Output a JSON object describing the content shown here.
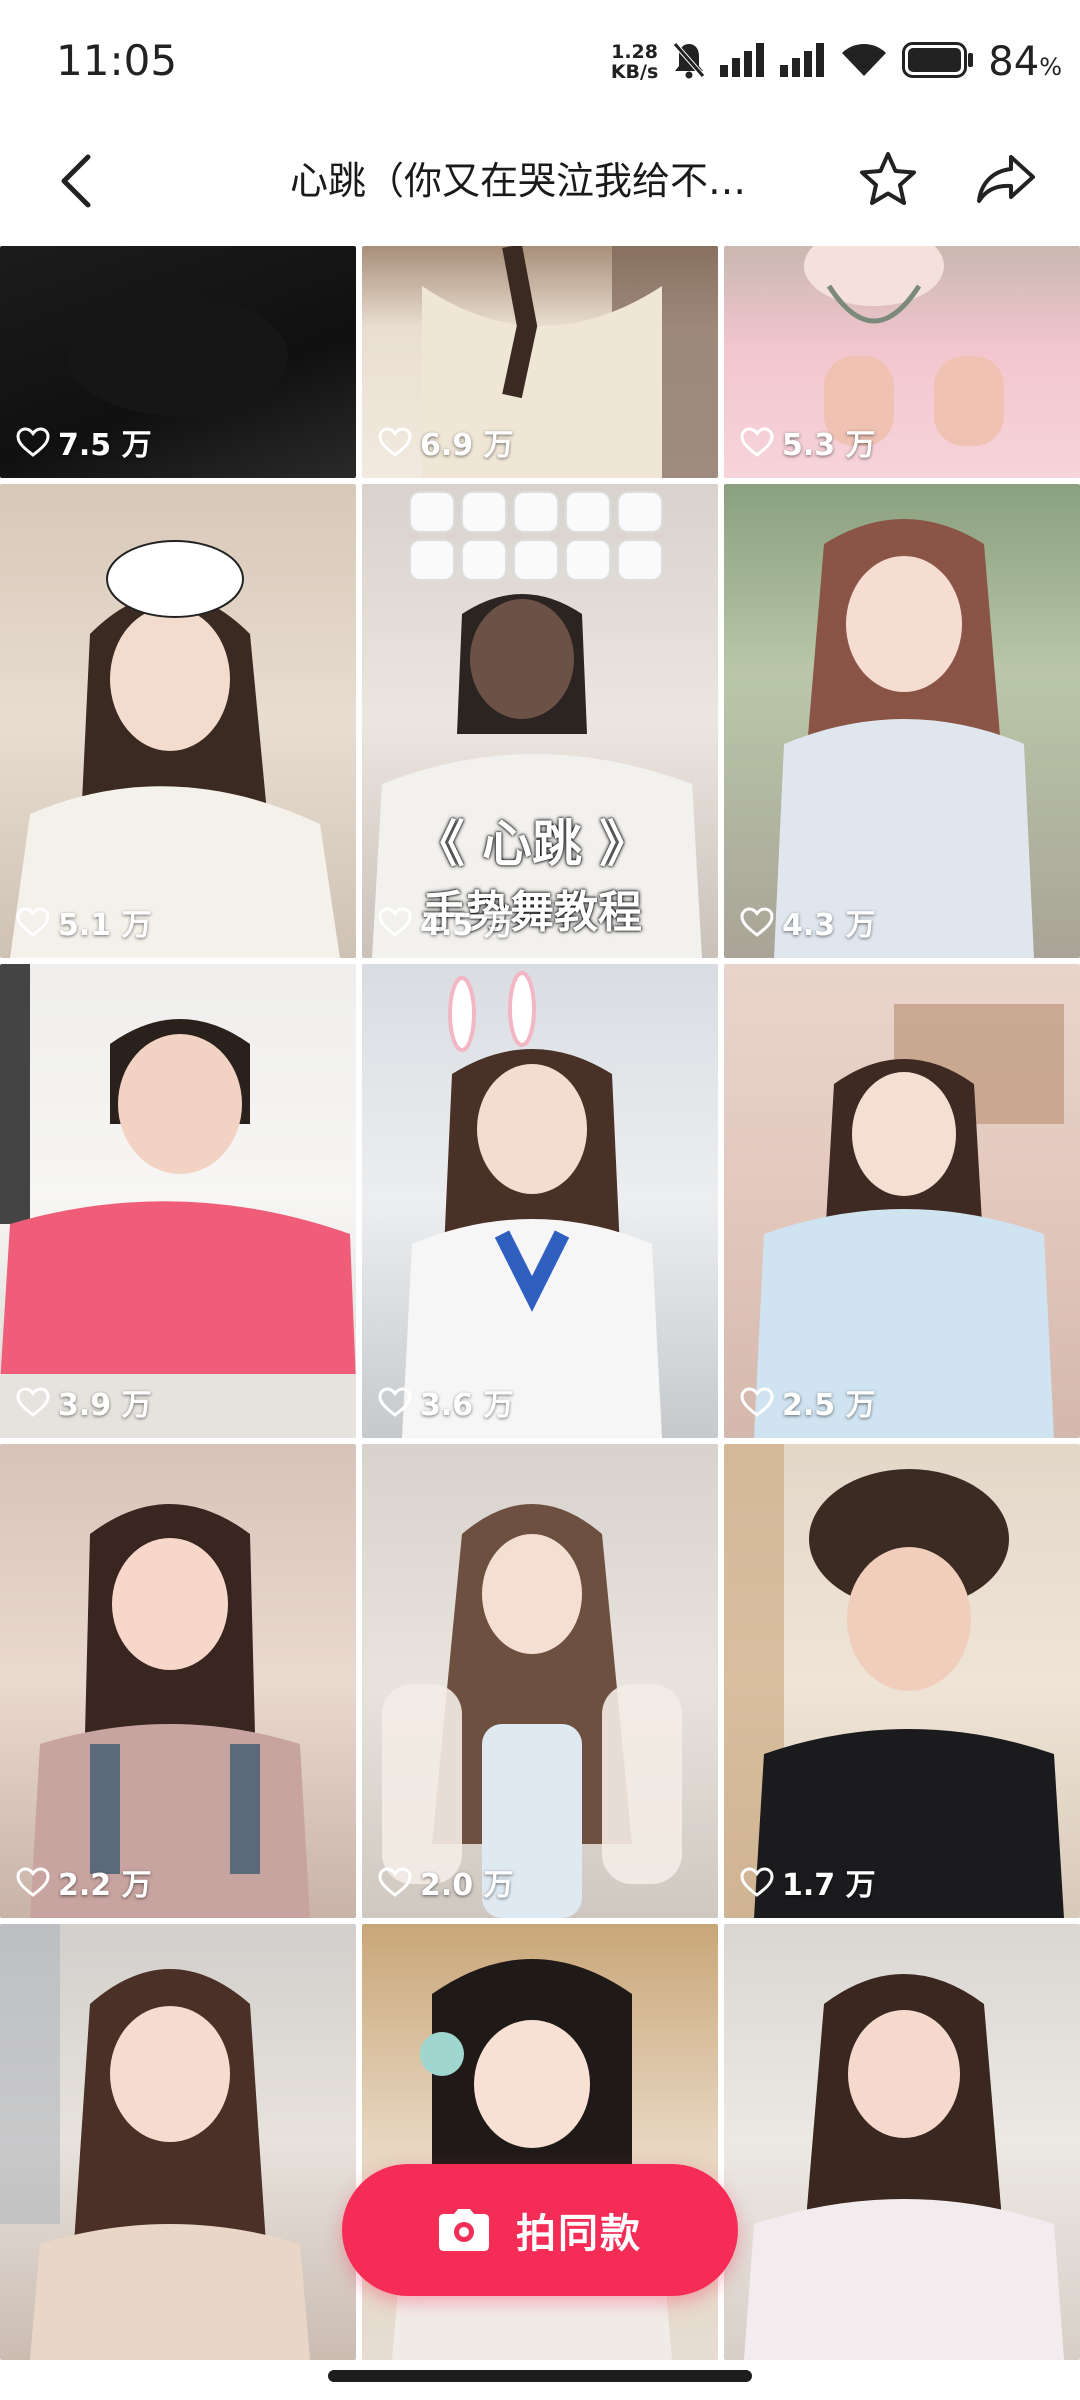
{
  "status_bar": {
    "time": "11:05",
    "net_speed_value": "1.28",
    "net_speed_unit": "KB/s",
    "battery_percent": "84",
    "battery_symbol": "%"
  },
  "header": {
    "title": "心跳（你又在哭泣我给不…",
    "icons": [
      "back-arrow-icon",
      "star-icon",
      "share-icon"
    ]
  },
  "videos": [
    {
      "likes": "7.5 万"
    },
    {
      "likes": "6.9 万"
    },
    {
      "likes": "5.3 万"
    },
    {
      "likes": "5.1 万"
    },
    {
      "likes": "4.5 万",
      "overlay_line1": "《 心跳 》",
      "overlay_line2": "手势舞教程"
    },
    {
      "likes": "4.3 万"
    },
    {
      "likes": "3.9 万"
    },
    {
      "likes": "3.6 万"
    },
    {
      "likes": "2.5 万"
    },
    {
      "likes": "2.2 万"
    },
    {
      "likes": "2.0 万"
    },
    {
      "likes": "1.7 万"
    },
    {
      "likes": ""
    },
    {
      "likes": ""
    },
    {
      "likes": ""
    }
  ],
  "shoot_button": {
    "label": "拍同款"
  },
  "colors": {
    "accent": "#f52d56",
    "background": "#ffffff"
  }
}
